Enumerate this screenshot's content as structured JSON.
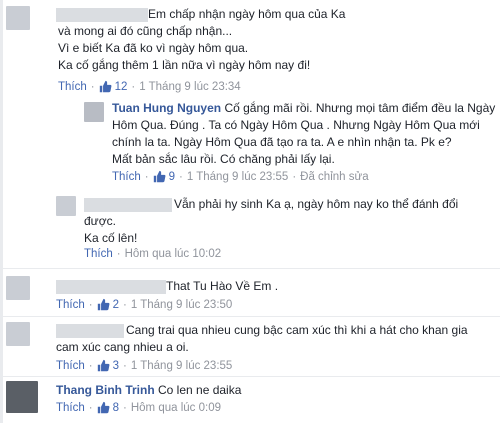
{
  "comments": [
    {
      "author": "",
      "lines": [
        "Em chấp nhận ngày hôm qua của Ka",
        "và mong ai đó cũng chấp nhận...",
        "Vì e biết Ka đã ko vì ngày hôm qua.",
        "Ka cố gắng thêm 1 lần nữa vì ngày hôm nay đi!"
      ],
      "like_label": "Thích",
      "like_count": "12",
      "time": "1 Tháng 9 lúc 23:34",
      "edited": ""
    },
    {
      "author": "Tuan Hung Nguyen",
      "lines": [
        "Cố gắng mãi rồi. Nhưng mọi tâm điểm đều la Ngày",
        "Hôm Qua. Đúng . Ta có Ngày Hôm Qua . Nhưng Ngày Hôm Qua mới",
        "chính la ta. Ngày Hôm Qua đã tạo ra ta. A e nhìn nhận ta. Pk e?",
        "Mất bản sắc lâu rồi. Có chăng phải lấy lại."
      ],
      "like_label": "Thích",
      "like_count": "9",
      "time": "1 Tháng 9 lúc 23:55",
      "edited": "Đã chỉnh sửa"
    },
    {
      "author": "",
      "lines": [
        "Vẫn phải hy sinh Ka ạ, ngày hôm nay ko thể đánh đổi",
        "được.",
        "Ka cố lên!"
      ],
      "like_label": "Thích",
      "like_count": "",
      "time": "Hôm qua lúc 10:02",
      "edited": ""
    },
    {
      "author": "",
      "lines": [
        "That Tu Hào Về Em ."
      ],
      "like_label": "Thích",
      "like_count": "2",
      "time": "1 Tháng 9 lúc 23:50",
      "edited": ""
    },
    {
      "author": "",
      "lines": [
        "Cang trai qua nhieu cung bậc cam xúc thì khi a hát cho khan gia",
        "cam xúc cang nhieu a oi."
      ],
      "like_label": "Thích",
      "like_count": "3",
      "time": "1 Tháng 9 lúc 23:55",
      "edited": ""
    },
    {
      "author": "Thang Binh Trinh",
      "lines": [
        "Co len ne daika"
      ],
      "like_label": "Thích",
      "like_count": "8",
      "time": "Hôm qua lúc 0:09",
      "edited": ""
    }
  ],
  "colors": {
    "link": "#365899",
    "like": "#4267b2",
    "meta": "#90949c",
    "text": "#1d2129"
  },
  "icons": {
    "like": "thumbs-up-icon"
  }
}
